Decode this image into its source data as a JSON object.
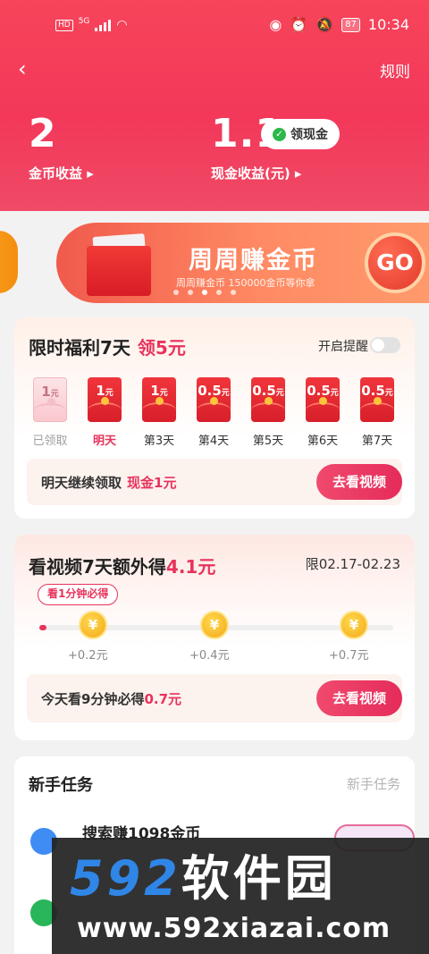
{
  "status_bar": {
    "hd": "HD",
    "network": "5G",
    "battery": "87",
    "time": "10:34"
  },
  "header": {
    "rules_label": "规则",
    "coin_value": "2",
    "coin_label": "金币收益 ▸",
    "cash_value": "1.1",
    "cash_label": "现金收益(元) ▸",
    "withdraw_label": "领现金"
  },
  "banner": {
    "title": "周周赚金币",
    "subtitle": "周周赚金币 150000金币等你拿",
    "go_label": "GO",
    "page_count": 5,
    "active_index": 2
  },
  "welfare": {
    "title": "限时福利7天",
    "highlight": "领5元",
    "remind_label": "开启提醒",
    "remind_on": false,
    "days": [
      {
        "amount": "1",
        "unit": "元",
        "label": "已领取",
        "state": "claimed"
      },
      {
        "amount": "1",
        "unit": "元",
        "label": "明天",
        "state": "next"
      },
      {
        "amount": "1",
        "unit": "元",
        "label": "第3天",
        "state": "normal"
      },
      {
        "amount": "0.5",
        "unit": "元",
        "label": "第4天",
        "state": "normal"
      },
      {
        "amount": "0.5",
        "unit": "元",
        "label": "第5天",
        "state": "normal"
      },
      {
        "amount": "0.5",
        "unit": "元",
        "label": "第6天",
        "state": "normal"
      },
      {
        "amount": "0.5",
        "unit": "元",
        "label": "第7天",
        "state": "normal"
      }
    ],
    "bar_text": "明天继续领取",
    "bar_highlight": "现金1元",
    "button": "去看视频"
  },
  "video": {
    "title": "看视频7天额外得",
    "highlight": "4.1元",
    "date_range": "限02.17-02.23",
    "tip": "看1分钟必得",
    "milestones": [
      {
        "label": "+0.2元"
      },
      {
        "label": "+0.4元"
      },
      {
        "label": "+0.7元"
      }
    ],
    "progress": 0.02,
    "bar_text": "今天看9分钟必得",
    "bar_highlight": "0.7元",
    "button": "去看视频",
    "coin_symbol": "¥"
  },
  "newbie": {
    "title": "新手任务",
    "right_label": "新手任务",
    "task_name": "搜索赚1098金币"
  },
  "watermark": {
    "brand_num": "592",
    "brand_cn": "软件园",
    "url": "www.592xiazai.com"
  },
  "colors": {
    "header": "#f3385a",
    "accent": "#e8335c",
    "coin": "#f4a91a"
  }
}
